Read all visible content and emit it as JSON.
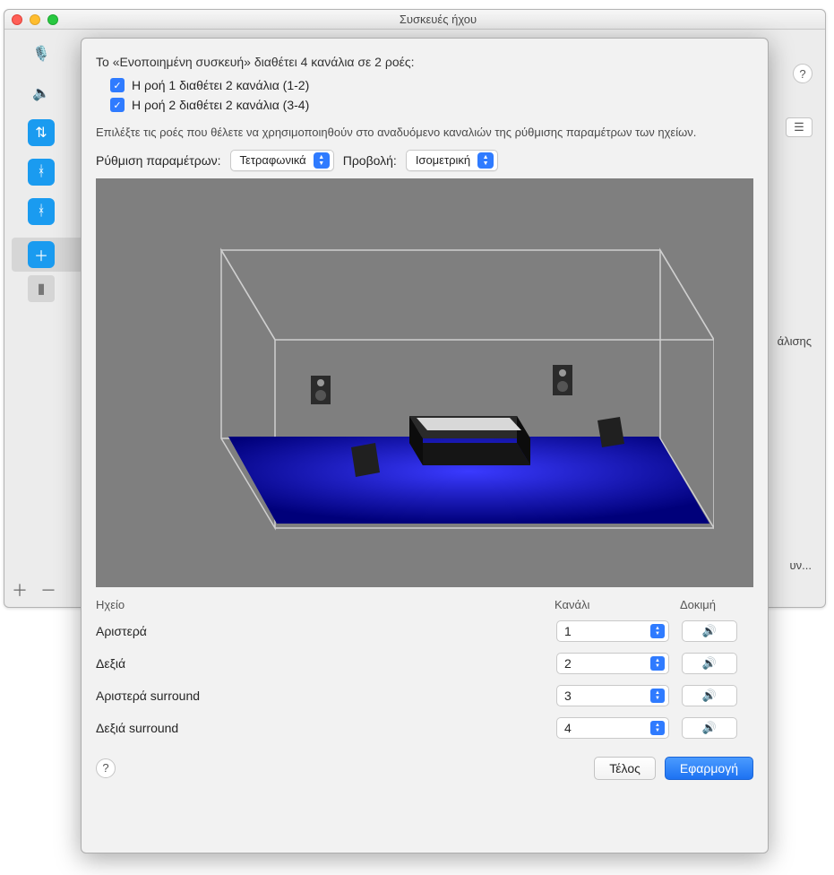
{
  "window": {
    "title": "Συσκευές ήχου",
    "frag_label_top": "άλισης",
    "frag_label_bot": "υν..."
  },
  "sheet": {
    "heading": "Το «Ενοποιημένη συσκευή» διαθέτει 4 κανάλια σε 2 ροές:",
    "stream1": "Η ροή 1 διαθέτει 2 κανάλια (1-2)",
    "stream2": "Η ροή 2 διαθέτει 2 κανάλια (3-4)",
    "instruction": "Επιλέξτε τις ροές που θέλετε να χρησιμοποιηθούν στο αναδυόμενο καναλιών της ρύθμισης παραμέτρων των ηχείων.",
    "config_label": "Ρύθμιση παραμέτρων:",
    "config_value": "Τετραφωνικά",
    "view_label": "Προβολή:",
    "view_value": "Ισομετρική",
    "table": {
      "col_speaker": "Ηχείο",
      "col_channel": "Κανάλι",
      "col_test": "Δοκιμή",
      "rows": [
        {
          "name": "Αριστερά",
          "ch": "1"
        },
        {
          "name": "Δεξιά",
          "ch": "2"
        },
        {
          "name": "Αριστερά surround",
          "ch": "3"
        },
        {
          "name": "Δεξιά surround",
          "ch": "4"
        }
      ]
    },
    "done_label": "Τέλος",
    "apply_label": "Εφαρμογή"
  }
}
